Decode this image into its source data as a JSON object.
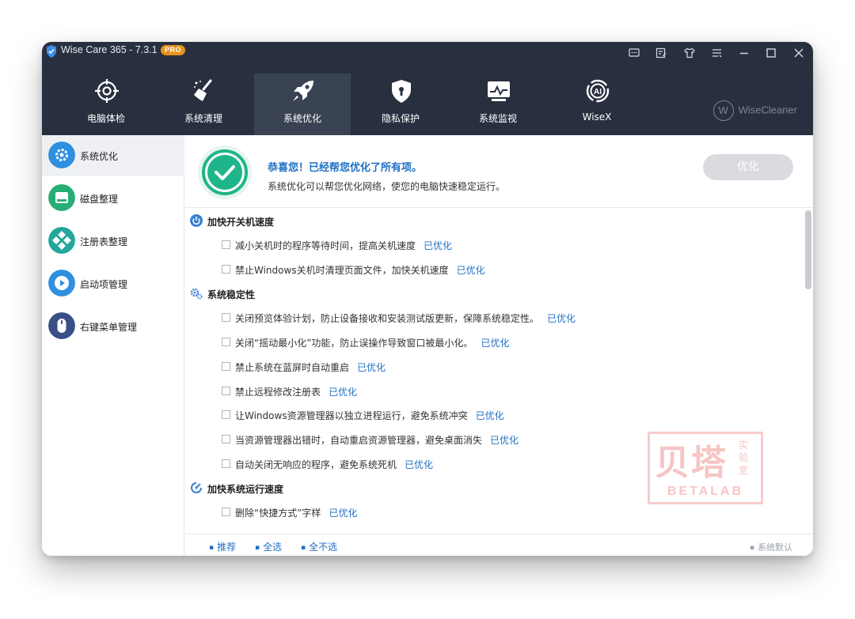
{
  "window": {
    "title": "Wise Care 365 - 7.3.1",
    "badge": "PRO",
    "brand": "WiseCleaner",
    "brand_mark": "W"
  },
  "titlebar_buttons": [
    {
      "name": "feedback-icon"
    },
    {
      "name": "notes-icon"
    },
    {
      "name": "skin-icon"
    },
    {
      "name": "menu-icon"
    },
    {
      "name": "minimize-icon"
    },
    {
      "name": "maximize-icon"
    },
    {
      "name": "close-icon"
    }
  ],
  "nav": {
    "items": [
      {
        "label": "电脑体检",
        "icon": "crosshair-icon"
      },
      {
        "label": "系统清理",
        "icon": "broom-icon"
      },
      {
        "label": "系统优化",
        "icon": "rocket-icon"
      },
      {
        "label": "隐私保护",
        "icon": "shield-lock-icon"
      },
      {
        "label": "系统监视",
        "icon": "monitor-icon"
      },
      {
        "label": "WiseX",
        "icon": "ai-icon"
      }
    ],
    "active_index": 2
  },
  "sidebar": {
    "items": [
      {
        "label": "系统优化",
        "icon": "gear-icon",
        "color": "#2f8fe0"
      },
      {
        "label": "磁盘整理",
        "icon": "disk-icon",
        "color": "#27ae74"
      },
      {
        "label": "注册表整理",
        "icon": "registry-icon",
        "color": "#22a79a"
      },
      {
        "label": "启动项管理",
        "icon": "startup-icon",
        "color": "#2f8fe0"
      },
      {
        "label": "右键菜单管理",
        "icon": "mouse-icon",
        "color": "#3a4f86"
      }
    ],
    "active_index": 0
  },
  "header": {
    "title": "恭喜您！已经帮您优化了所有项。",
    "subtitle": "系统优化可以帮您优化网络，使您的电脑快速稳定运行。",
    "button": "优化"
  },
  "sections": [
    {
      "title": "加快开关机速度",
      "icon": "power-icon",
      "items": [
        {
          "text": "减小关机时的程序等待时间，提高关机速度",
          "status": "已优化"
        },
        {
          "text": "禁止Windows关机时清理页面文件，加快关机速度",
          "status": "已优化"
        }
      ]
    },
    {
      "title": "系统稳定性",
      "icon": "gears-icon",
      "items": [
        {
          "text": "关闭预览体验计划，防止设备接收和安装测试版更新，保障系统稳定性。",
          "status": "已优化"
        },
        {
          "text": "关闭“摇动最小化”功能，防止误操作导致窗口被最小化。",
          "status": "已优化"
        },
        {
          "text": "禁止系统在蓝屏时自动重启",
          "status": "已优化"
        },
        {
          "text": "禁止远程修改注册表",
          "status": "已优化"
        },
        {
          "text": "让Windows资源管理器以独立进程运行，避免系统冲突",
          "status": "已优化"
        },
        {
          "text": "当资源管理器出错时，自动重启资源管理器，避免桌面消失",
          "status": "已优化"
        },
        {
          "text": "自动关闭无响应的程序，避免系统死机",
          "status": "已优化"
        }
      ]
    },
    {
      "title": "加快系统运行速度",
      "icon": "speed-icon",
      "items": [
        {
          "text": "删除“快捷方式”字样",
          "status": "已优化"
        }
      ]
    }
  ],
  "watermark": {
    "big": "贝塔",
    "side": "实验室",
    "small": "BETALAB"
  },
  "footer": {
    "recommend": "推荐",
    "select_all": "全选",
    "select_none": "全不选",
    "default": "系统默认"
  },
  "colors": {
    "titlebar_bg": "#283040",
    "nav_active_bg": "#3a4354",
    "accent_blue": "#1f6fc4",
    "check_green": "#1fb58a",
    "pro_orange": "#e8921c"
  }
}
